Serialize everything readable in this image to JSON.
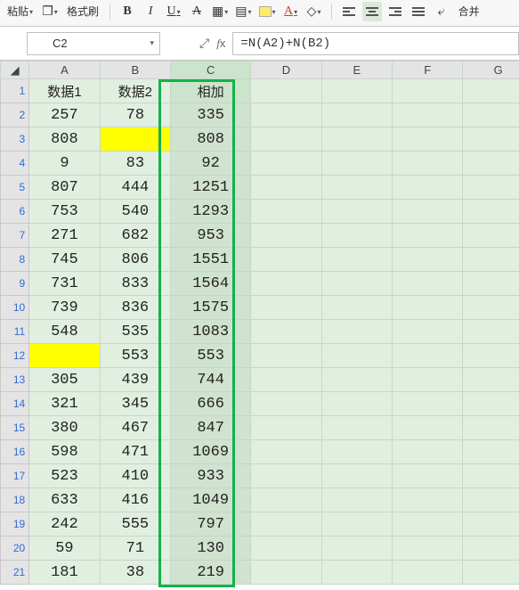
{
  "toolbar": {
    "paste_label": "粘贴",
    "format_painter_label": "格式刷",
    "merge_label": "合并"
  },
  "address_bar": {
    "cell_ref": "C2",
    "formula": "=N(A2)+N(B2)"
  },
  "columns": [
    "A",
    "B",
    "C",
    "D",
    "E",
    "F",
    "G"
  ],
  "headers": {
    "a": "数据1",
    "b": "数据2",
    "c": "相加"
  },
  "rows": [
    {
      "n": 1,
      "a": "数据1",
      "b": "数据2",
      "c": "相加",
      "header": true
    },
    {
      "n": 2,
      "a": "257",
      "b": "78",
      "c": "335"
    },
    {
      "n": 3,
      "a": "808",
      "b": "",
      "c": "808",
      "b_yellow": true
    },
    {
      "n": 4,
      "a": "9",
      "b": "83",
      "c": "92"
    },
    {
      "n": 5,
      "a": "807",
      "b": "444",
      "c": "1251"
    },
    {
      "n": 6,
      "a": "753",
      "b": "540",
      "c": "1293"
    },
    {
      "n": 7,
      "a": "271",
      "b": "682",
      "c": "953"
    },
    {
      "n": 8,
      "a": "745",
      "b": "806",
      "c": "1551"
    },
    {
      "n": 9,
      "a": "731",
      "b": "833",
      "c": "1564"
    },
    {
      "n": 10,
      "a": "739",
      "b": "836",
      "c": "1575"
    },
    {
      "n": 11,
      "a": "548",
      "b": "535",
      "c": "1083"
    },
    {
      "n": 12,
      "a": "",
      "b": "553",
      "c": "553",
      "a_yellow": true
    },
    {
      "n": 13,
      "a": "305",
      "b": "439",
      "c": "744"
    },
    {
      "n": 14,
      "a": "321",
      "b": "345",
      "c": "666"
    },
    {
      "n": 15,
      "a": "380",
      "b": "467",
      "c": "847"
    },
    {
      "n": 16,
      "a": "598",
      "b": "471",
      "c": "1069"
    },
    {
      "n": 17,
      "a": "523",
      "b": "410",
      "c": "933"
    },
    {
      "n": 18,
      "a": "633",
      "b": "416",
      "c": "1049"
    },
    {
      "n": 19,
      "a": "242",
      "b": "555",
      "c": "797"
    },
    {
      "n": 20,
      "a": "59",
      "b": "71",
      "c": "130"
    },
    {
      "n": 21,
      "a": "181",
      "b": "38",
      "c": "219"
    }
  ]
}
